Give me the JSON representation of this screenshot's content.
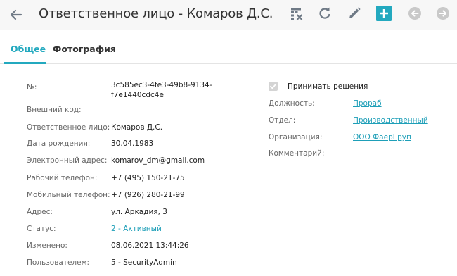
{
  "header": {
    "title": "Ответственное лицо - Комаров Д.С."
  },
  "tabs": [
    {
      "label": "Общее",
      "active": true
    },
    {
      "label": "Фотография",
      "active": false
    }
  ],
  "fields": {
    "number": {
      "label": "№:",
      "value_line1": "3c585ec3-4fe3-49b8-9134-",
      "value_line2": "f7e1440cdc4e"
    },
    "external_code": {
      "label": "Внешний код:",
      "value": ""
    },
    "responsible": {
      "label": "Ответственное лицо:",
      "value": "Комаров Д.С."
    },
    "birth_date": {
      "label": "Дата рождения:",
      "value": "30.04.1983"
    },
    "email": {
      "label": "Электронный адрес:",
      "value": "komarov_dm@gmail.com"
    },
    "work_phone": {
      "label": "Рабочий телефон:",
      "value": "+7 (495) 150-21-75"
    },
    "mobile_phone": {
      "label": "Мобильный телефон:",
      "value": "+7 (926) 280-21-99"
    },
    "address": {
      "label": "Адрес:",
      "value": "ул. Аркадия, 3"
    },
    "status": {
      "label": "Статус:",
      "value": "2 - Активный"
    },
    "changed": {
      "label": "Изменено:",
      "value": "08.06.2021 13:44:26"
    },
    "user": {
      "label": "Пользователем:",
      "value": "5 - SecurityAdmin"
    }
  },
  "right": {
    "decisions": {
      "label": "Принимать решения",
      "checked": true
    },
    "position": {
      "label": "Должность:",
      "value": "Прораб"
    },
    "department": {
      "label": "Отдел:",
      "value": "Производственный"
    },
    "organization": {
      "label": "Организация:",
      "value": "ООО ФаерГруп"
    },
    "comment": {
      "label": "Комментарий:",
      "value": ""
    }
  },
  "colors": {
    "accent": "#23a9bf",
    "link": "#1e9fb8",
    "toolbar_icon": "#6f7a86",
    "disabled_icon": "#c9c9c9"
  },
  "icons": [
    "arrow-left-icon",
    "table-clear-icon",
    "refresh-icon",
    "pencil-icon",
    "plus-icon",
    "circle-arrow-left-icon",
    "circle-arrow-right-icon",
    "check-icon"
  ]
}
